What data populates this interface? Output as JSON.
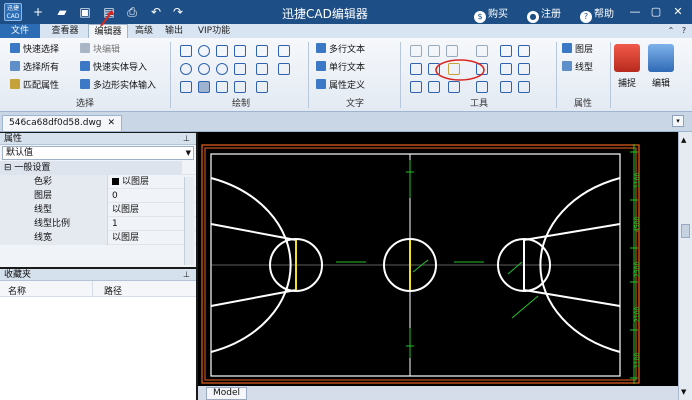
{
  "titlebar": {
    "logo_line1": "迅捷",
    "logo_line2": "CAD",
    "title": "迅捷CAD编辑器",
    "buy": "购买",
    "register": "注册",
    "help": "帮助",
    "quick_access_icons": [
      "new-icon",
      "open-icon",
      "save-icon",
      "save-as-icon",
      "print-icon",
      "undo-icon",
      "redo-icon"
    ]
  },
  "tabs": [
    "文件",
    "查看器",
    "编辑器",
    "高级",
    "输出",
    "VIP功能"
  ],
  "active_tab": "编辑器",
  "ribbon": {
    "select": {
      "label": "选择",
      "items": [
        "快速选择",
        "选择所有",
        "匹配属性",
        "块编辑",
        "快速实体导入",
        "多边形实体输入"
      ]
    },
    "draw": {
      "label": "绘制"
    },
    "text": {
      "label": "文字",
      "items": [
        "多行文本",
        "单行文本",
        "属性定义"
      ]
    },
    "tools": {
      "label": "工具"
    },
    "props": {
      "label": "属性",
      "items": [
        "图层",
        "线型"
      ]
    },
    "capture": {
      "label": "捕捉"
    },
    "edit": {
      "label": "编辑"
    }
  },
  "document": {
    "tab": "546ca68df0d58.dwg"
  },
  "properties_panel": {
    "title": "属性",
    "combo": "默认值",
    "category": "一般设置",
    "rows": [
      {
        "key": "色彩",
        "value": "以图层"
      },
      {
        "key": "图层",
        "value": "0"
      },
      {
        "key": "线型",
        "value": "以图层"
      },
      {
        "key": "线型比例",
        "value": "1"
      },
      {
        "key": "线宽",
        "value": "以图层"
      }
    ]
  },
  "favorites_panel": {
    "title": "收藏夹",
    "col_name": "名称",
    "col_path": "路径"
  },
  "drawing": {
    "dim_vertical_1": "1100",
    "dim_vertical_2": "4500",
    "dim_vertical_3": "2500",
    "dim_vertical_4": "2100",
    "dim_vertical_5": "1100"
  },
  "model_tab": "Model",
  "colors": {
    "title_bg": "#1d4f86",
    "annotation_red": "#d8261f",
    "court_orange": "#e8641b",
    "dim_green": "#22c428",
    "key_yellow": "#f2e21c"
  }
}
